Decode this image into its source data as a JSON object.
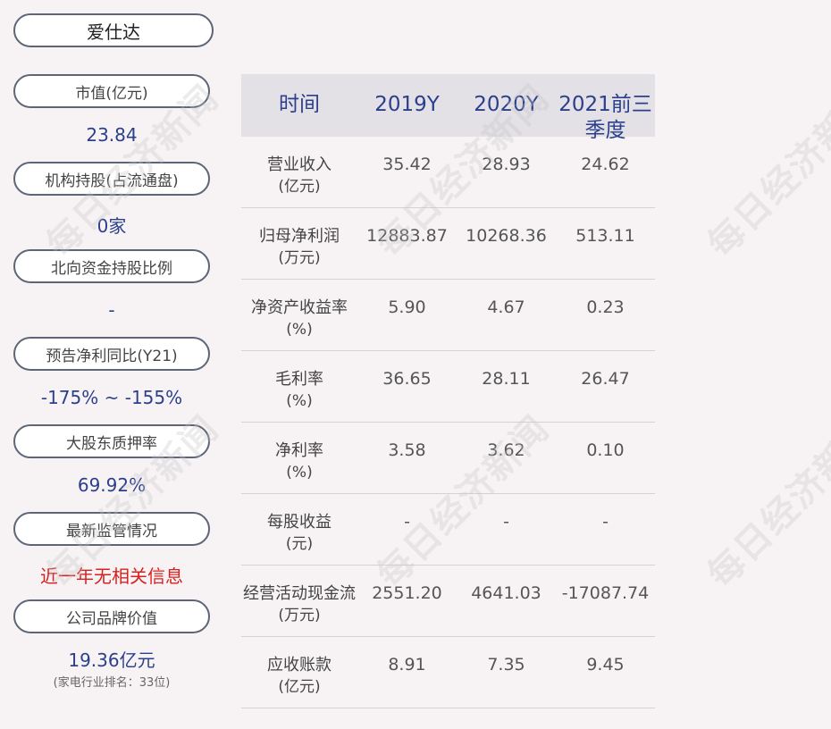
{
  "company": "爱仕达",
  "metrics": [
    {
      "label": "市值(亿元)",
      "value": "23.84"
    },
    {
      "label": "机构持股(占流通盘)",
      "value": "0家"
    },
    {
      "label": "北向资金持股比例",
      "value": "-"
    },
    {
      "label": "预告净利同比(Y21)",
      "value": "-175% ~ -155%"
    },
    {
      "label": "大股东质押率",
      "value": "69.92%"
    },
    {
      "label": "最新监管情况",
      "value": "近一年无相关信息",
      "value_color": "#d8201e"
    },
    {
      "label": "公司品牌价值",
      "value": "19.36亿元",
      "sub": "(家电行业排名：33位)"
    }
  ],
  "table": {
    "headers": [
      "时间",
      "2019Y",
      "2020Y",
      "2021前三季度"
    ],
    "rows": [
      {
        "label": "营业收入",
        "unit": "(亿元)",
        "values": [
          "35.42",
          "28.93",
          "24.62"
        ]
      },
      {
        "label": "归母净利润",
        "unit": "(万元)",
        "values": [
          "12883.87",
          "10268.36",
          "513.11"
        ]
      },
      {
        "label": "净资产收益率",
        "unit": "(%)",
        "values": [
          "5.90",
          "4.67",
          "0.23"
        ]
      },
      {
        "label": "毛利率",
        "unit": "(%)",
        "values": [
          "36.65",
          "28.11",
          "26.47"
        ]
      },
      {
        "label": "净利率",
        "unit": "(%)",
        "values": [
          "3.58",
          "3.62",
          "0.10"
        ]
      },
      {
        "label": "每股收益",
        "unit": "(元)",
        "values": [
          "-",
          "-",
          "-"
        ]
      },
      {
        "label": "经营活动现金流",
        "unit": "(万元)",
        "values": [
          "2551.20",
          "4641.03",
          "-17087.74"
        ]
      },
      {
        "label": "应收账款",
        "unit": "(亿元)",
        "values": [
          "8.91",
          "7.35",
          "9.45"
        ]
      }
    ]
  },
  "watermark": "每日经济新闻",
  "colors": {
    "accent": "#2b3f8c",
    "alert": "#d8201e",
    "header_bg": "#e4e1e6",
    "page_bg": "#f7f3f5"
  }
}
